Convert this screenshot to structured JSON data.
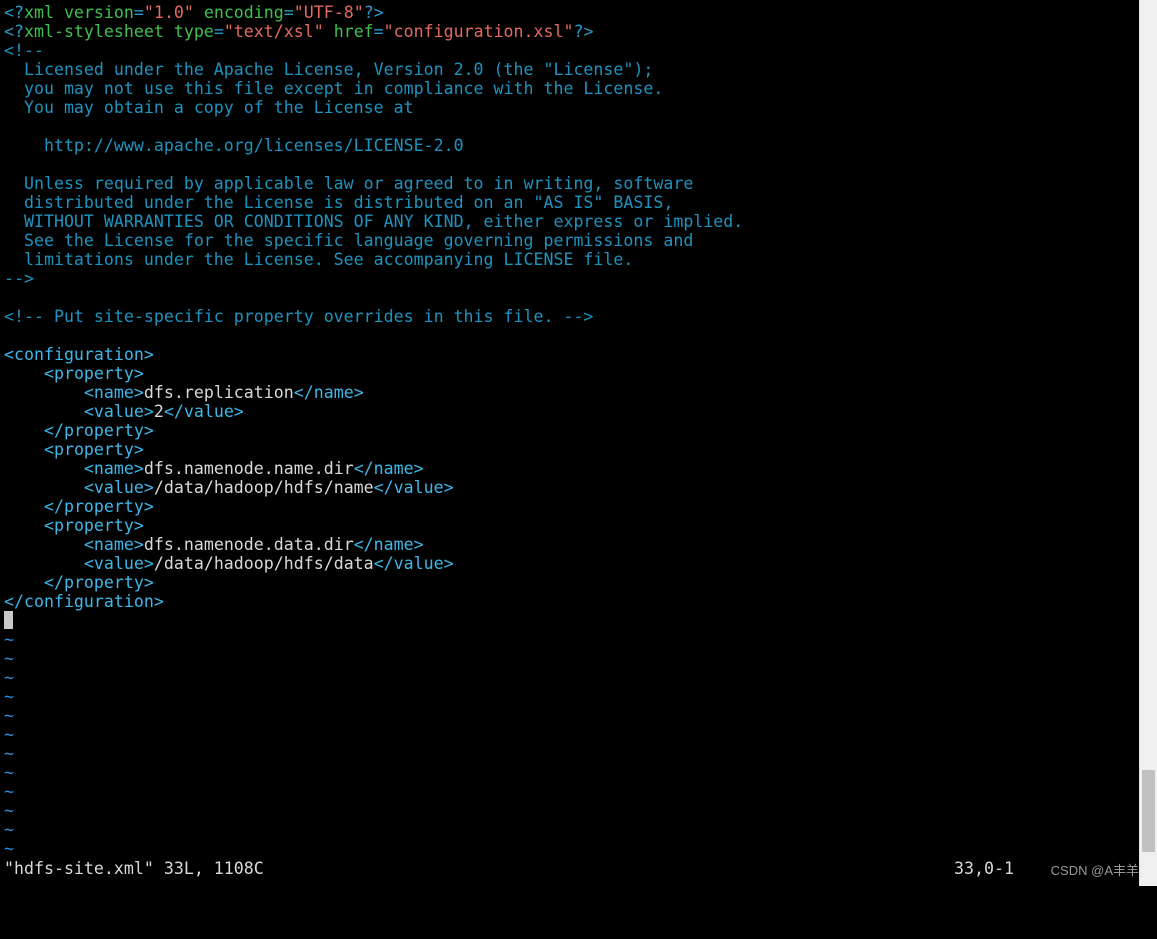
{
  "editor": {
    "lines": [
      [
        [
          "pi",
          "<?"
        ],
        [
          "attr",
          "xml version"
        ],
        [
          "pi",
          "="
        ],
        [
          "str",
          "\"1.0\""
        ],
        [
          "attr",
          " encoding"
        ],
        [
          "pi",
          "="
        ],
        [
          "str",
          "\"UTF-8\""
        ],
        [
          "pi",
          "?>"
        ]
      ],
      [
        [
          "pi",
          "<?"
        ],
        [
          "attr",
          "xml-stylesheet type"
        ],
        [
          "pi",
          "="
        ],
        [
          "str",
          "\"text/xsl\""
        ],
        [
          "attr",
          " href"
        ],
        [
          "pi",
          "="
        ],
        [
          "str",
          "\"configuration.xsl\""
        ],
        [
          "pi",
          "?>"
        ]
      ],
      [
        [
          "com",
          "<!--"
        ]
      ],
      [
        [
          "com",
          "  Licensed under the Apache License, Version 2.0 (the \"License\");"
        ]
      ],
      [
        [
          "com",
          "  you may not use this file except in compliance with the License."
        ]
      ],
      [
        [
          "com",
          "  You may obtain a copy of the License at"
        ]
      ],
      [],
      [
        [
          "com",
          "    http://www.apache.org/licenses/LICENSE-2.0"
        ]
      ],
      [],
      [
        [
          "com",
          "  Unless required by applicable law or agreed to in writing, software"
        ]
      ],
      [
        [
          "com",
          "  distributed under the License is distributed on an \"AS IS\" BASIS,"
        ]
      ],
      [
        [
          "com",
          "  WITHOUT WARRANTIES OR CONDITIONS OF ANY KIND, either express or implied."
        ]
      ],
      [
        [
          "com",
          "  See the License for the specific language governing permissions and"
        ]
      ],
      [
        [
          "com",
          "  limitations under the License. See accompanying LICENSE file."
        ]
      ],
      [
        [
          "com",
          "-->"
        ]
      ],
      [],
      [
        [
          "com",
          "<!-- Put site-specific property overrides in this file. -->"
        ]
      ],
      [],
      [
        [
          "tag",
          "<configuration>"
        ]
      ],
      [
        [
          "text",
          "    "
        ],
        [
          "tag",
          "<property>"
        ]
      ],
      [
        [
          "text",
          "        "
        ],
        [
          "tag",
          "<name>"
        ],
        [
          "text",
          "dfs.replication"
        ],
        [
          "tag",
          "</name>"
        ]
      ],
      [
        [
          "text",
          "        "
        ],
        [
          "tag",
          "<value>"
        ],
        [
          "text",
          "2"
        ],
        [
          "tag",
          "</value>"
        ]
      ],
      [
        [
          "text",
          "    "
        ],
        [
          "tag",
          "</property>"
        ]
      ],
      [
        [
          "text",
          "    "
        ],
        [
          "tag",
          "<property>"
        ]
      ],
      [
        [
          "text",
          "        "
        ],
        [
          "tag",
          "<name>"
        ],
        [
          "text",
          "dfs.namenode.name.dir"
        ],
        [
          "tag",
          "</name>"
        ]
      ],
      [
        [
          "text",
          "        "
        ],
        [
          "tag",
          "<value>"
        ],
        [
          "text",
          "/data/hadoop/hdfs/name"
        ],
        [
          "tag",
          "</value>"
        ]
      ],
      [
        [
          "text",
          "    "
        ],
        [
          "tag",
          "</property>"
        ]
      ],
      [
        [
          "text",
          "    "
        ],
        [
          "tag",
          "<property>"
        ]
      ],
      [
        [
          "text",
          "        "
        ],
        [
          "tag",
          "<name>"
        ],
        [
          "text",
          "dfs.namenode.data.dir"
        ],
        [
          "tag",
          "</name>"
        ]
      ],
      [
        [
          "text",
          "        "
        ],
        [
          "tag",
          "<value>"
        ],
        [
          "text",
          "/data/hadoop/hdfs/data"
        ],
        [
          "tag",
          "</value>"
        ]
      ],
      [
        [
          "text",
          "    "
        ],
        [
          "tag",
          "</property>"
        ]
      ],
      [
        [
          "tag",
          "</configuration>"
        ]
      ]
    ],
    "cursor_line_index": 32,
    "empty_line_marker": "~",
    "empty_line_count": 12
  },
  "status": {
    "file_info": "\"hdfs-site.xml\" 33L, 1108C",
    "position": "33,0-1",
    "watermark": "CSDN @A丰羊"
  },
  "colors": {
    "background": "#000000",
    "xml_declaration": "#2c99c8",
    "attribute": "#3ec04f",
    "string": "#e36a5f",
    "comment": "#1d93bf",
    "tag": "#3fb7e9",
    "text": "#d9d9d9",
    "tilde": "#2e8fe0"
  }
}
